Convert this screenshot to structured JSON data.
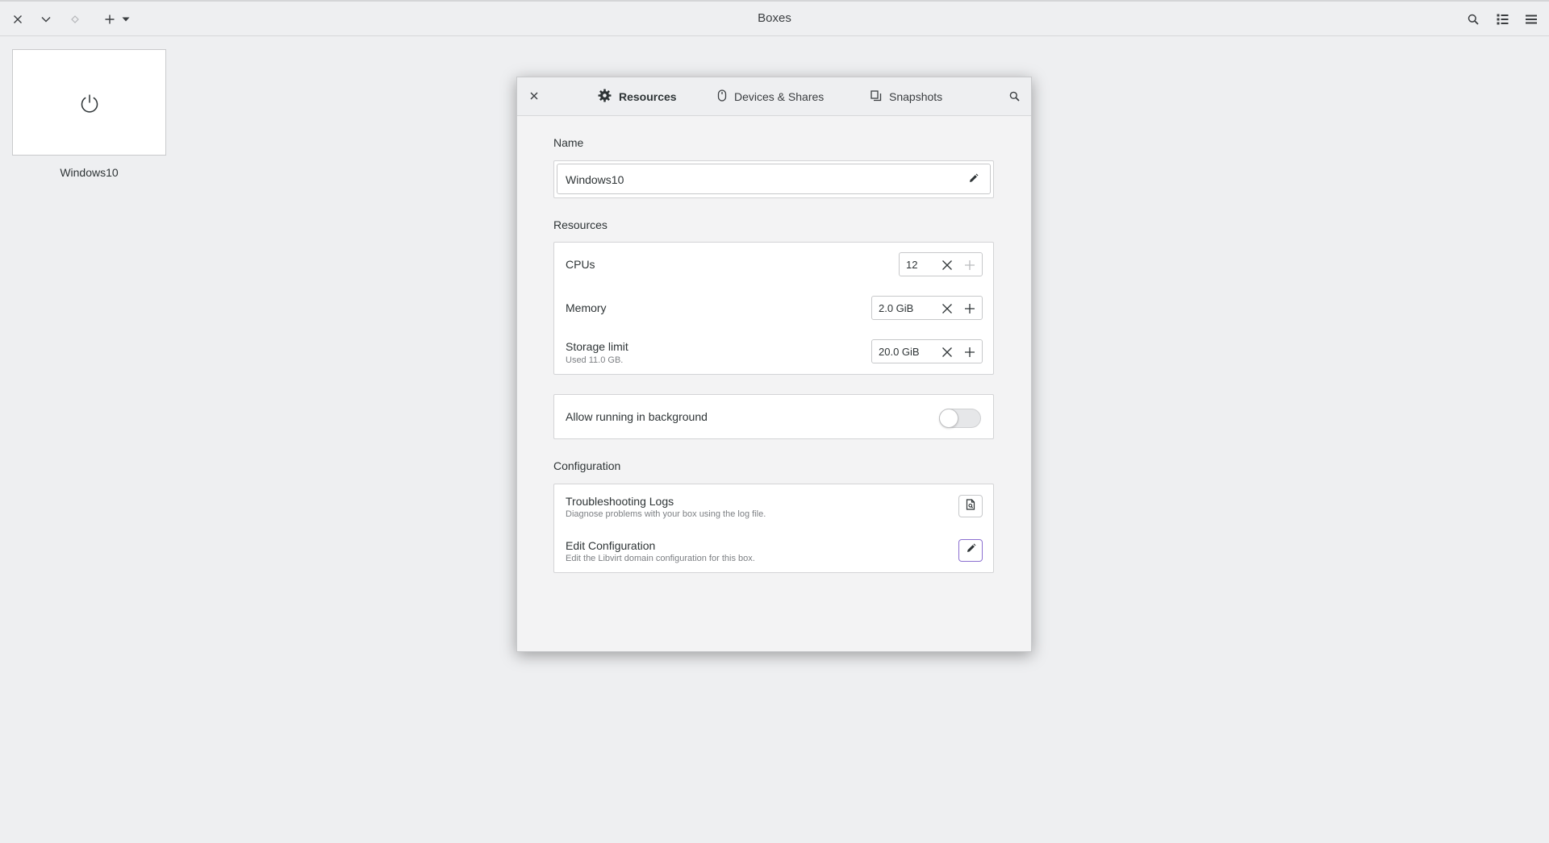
{
  "app": {
    "title": "Boxes"
  },
  "topbar": {
    "icons": [
      "close-icon",
      "chevron-down-icon",
      "diamond-icon",
      "plus-icon",
      "dropdown-triangle-icon",
      "search-icon",
      "list-view-icon",
      "hamburger-menu-icon"
    ]
  },
  "boxes": [
    {
      "name": "Windows10",
      "icon": "power-icon"
    }
  ],
  "dialog": {
    "tabs": [
      {
        "label": "Resources",
        "icon": "gear-icon",
        "active": true
      },
      {
        "label": "Devices & Shares",
        "icon": "mouse-icon",
        "active": false
      },
      {
        "label": "Snapshots",
        "icon": "snapshot-icon",
        "active": false
      }
    ],
    "name_section": {
      "label": "Name",
      "value": "Windows10"
    },
    "resources_section": {
      "label": "Resources",
      "rows": [
        {
          "title": "CPUs",
          "value": "12",
          "subtitle": ""
        },
        {
          "title": "Memory",
          "value": "2.0 GiB",
          "subtitle": ""
        },
        {
          "title": "Storage limit",
          "value": "20.0 GiB",
          "subtitle": "Used 11.0 GB."
        }
      ]
    },
    "background": {
      "label": "Allow running in background",
      "enabled": false
    },
    "configuration_section": {
      "label": "Configuration",
      "rows": [
        {
          "title": "Troubleshooting Logs",
          "subtitle": "Diagnose problems with your box using the log file."
        },
        {
          "title": "Edit Configuration",
          "subtitle": "Edit the Libvirt domain configuration for this box."
        }
      ]
    }
  },
  "colors": {
    "background": "#eeeff1",
    "card": "#ffffff",
    "focus_border": "#8b6fd0"
  }
}
